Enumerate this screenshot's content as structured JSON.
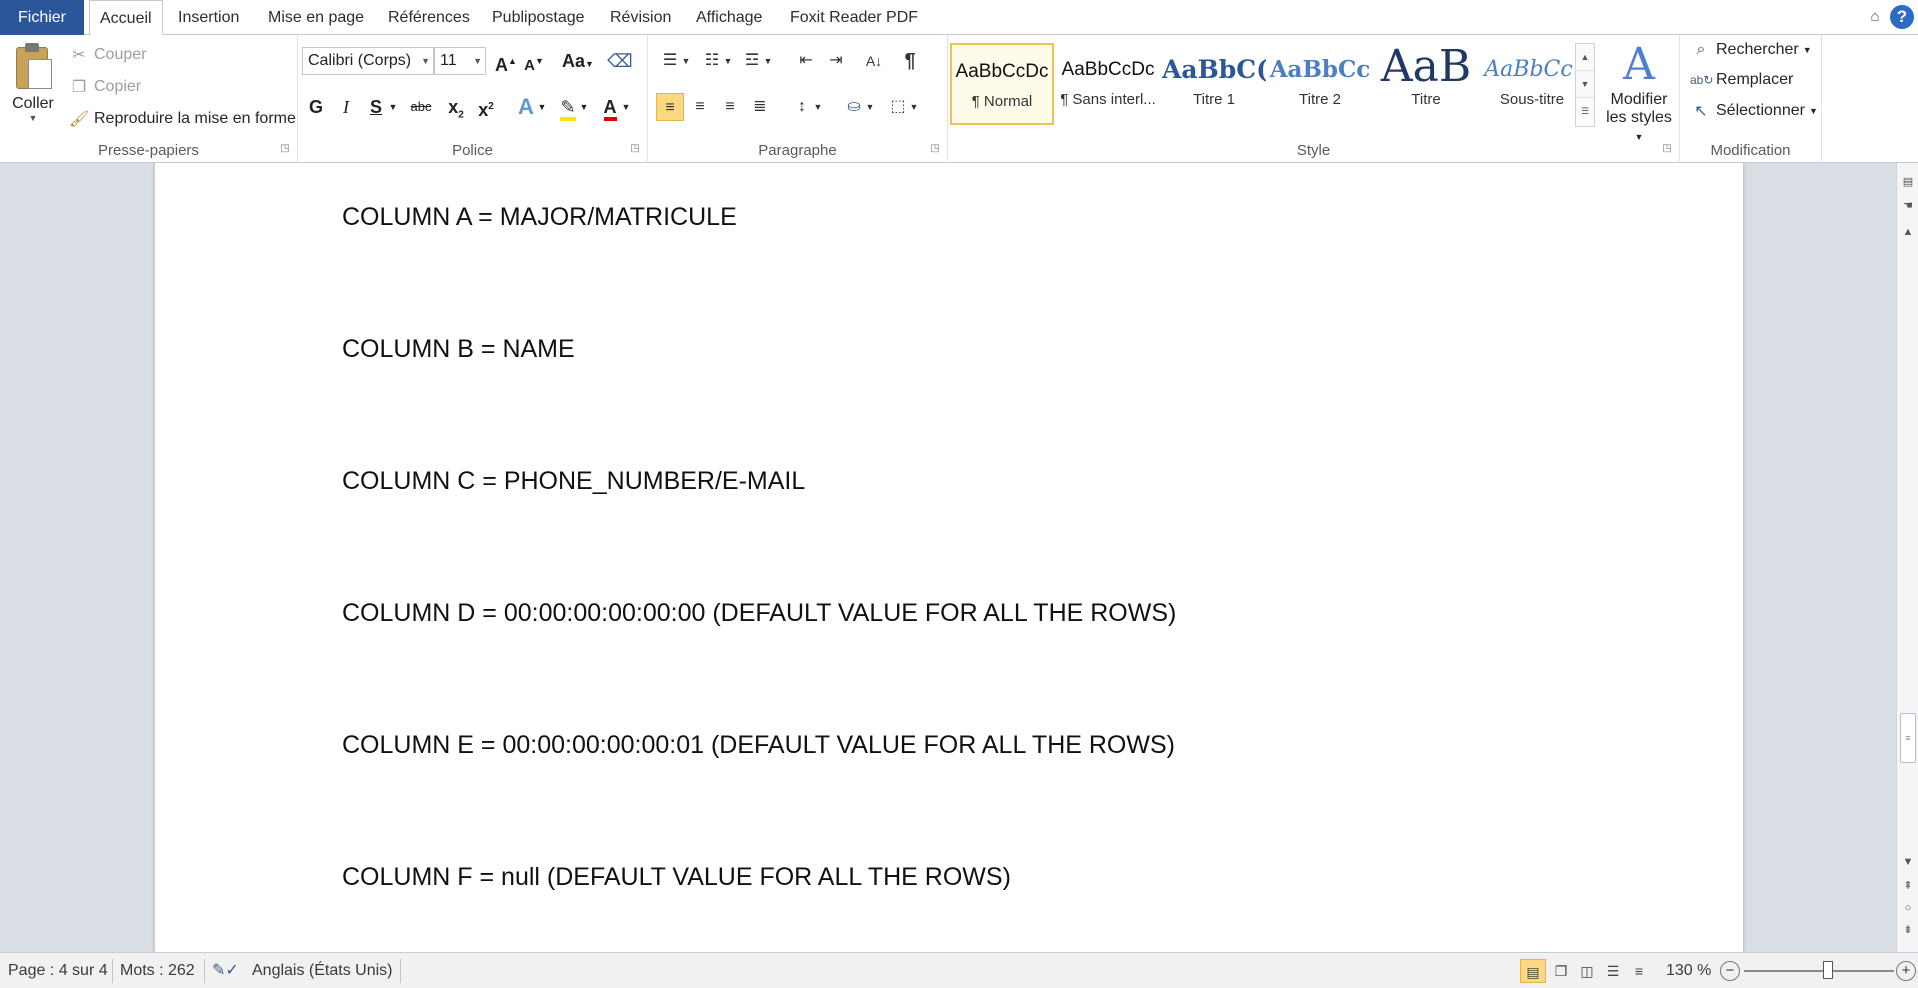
{
  "tabs": {
    "file": "Fichier",
    "items": [
      "Accueil",
      "Insertion",
      "Mise en page",
      "Références",
      "Publipostage",
      "Révision",
      "Affichage",
      "Foxit Reader PDF"
    ]
  },
  "ribbon": {
    "clipboard": {
      "label": "Presse-papiers",
      "paste": "Coller",
      "cut": "Couper",
      "copy": "Copier",
      "format_painter": "Reproduire la mise en forme"
    },
    "font": {
      "label": "Police",
      "font_name": "Calibri (Corps)",
      "font_size": "11",
      "bold": "G",
      "italic": "I",
      "strike_label": "abc"
    },
    "paragraph": {
      "label": "Paragraphe"
    },
    "style": {
      "label": "Style",
      "items": [
        {
          "preview": "AaBbCcDc",
          "name": "¶ Normal"
        },
        {
          "preview": "AaBbCcDc",
          "name": "¶ Sans interl..."
        },
        {
          "preview": "AaBbC(",
          "name": "Titre 1"
        },
        {
          "preview": "AaBbCc",
          "name": "Titre 2"
        },
        {
          "preview": "AaB",
          "name": "Titre"
        },
        {
          "preview": "AaBbCc.",
          "name": "Sous-titre"
        }
      ],
      "modify_line1": "Modifier",
      "modify_line2": "les styles"
    },
    "editing": {
      "label": "Modification",
      "find": "Rechercher",
      "replace": "Remplacer",
      "select": "Sélectionner"
    }
  },
  "document": {
    "paragraphs": [
      "COLUMN A = MAJOR/MATRICULE",
      "COLUMN B = NAME",
      "COLUMN C = PHONE_NUMBER/E-MAIL",
      "COLUMN D = 00:00:00:00:00:00 (DEFAULT VALUE FOR ALL THE ROWS)",
      "COLUMN E = 00:00:00:00:00:01 (DEFAULT VALUE FOR ALL THE ROWS)",
      "COLUMN F = null (DEFAULT VALUE FOR ALL THE ROWS)"
    ]
  },
  "status": {
    "page": "Page : 4 sur 4",
    "words": "Mots : 262",
    "language": "Anglais (États Unis)",
    "zoom": "130 %",
    "zoom_fraction": 0.56
  },
  "colors": {
    "file_tab": "#2b579a",
    "accent_yellow": "#fcd981",
    "highlight_yellow": "#ffe600",
    "font_red": "#e00000"
  }
}
